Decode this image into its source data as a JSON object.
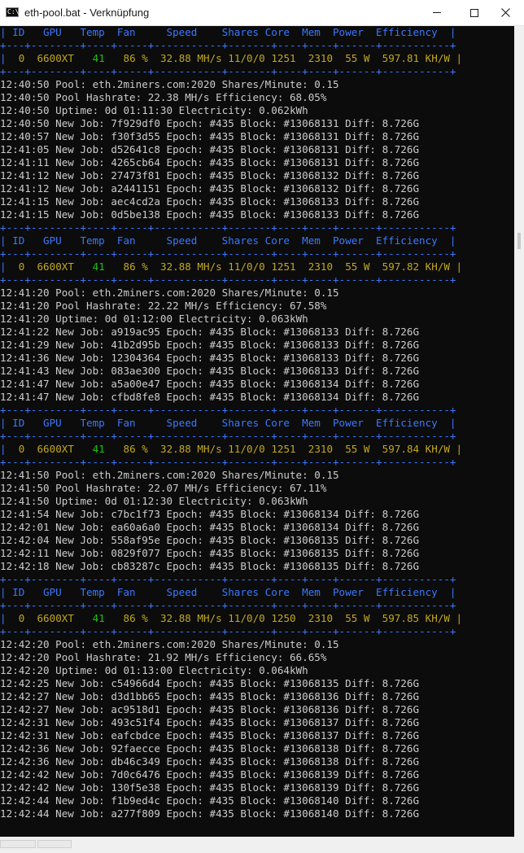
{
  "window": {
    "title": "eth-pool.bat - Verknüpfung",
    "icon": "cmd-icon",
    "controls": [
      "minimize-button",
      "maximize-button",
      "close-button"
    ]
  },
  "colors": {
    "background": "#0c0c0c",
    "table": "#3b78ff",
    "log_text": "#cccccc",
    "temp_green": "#16c60c",
    "value_yellow": "#c1a820"
  },
  "console": {
    "lines": [
      {
        "type": "hdr",
        "text": "| ID   GPU   Temp  Fan     Speed    Shares Core  Mem  Power  Efficiency  |"
      },
      {
        "type": "sep",
        "text": "+---+--------+----+-----+-----------+-------+----+----+------+-----------+"
      },
      {
        "type": "data",
        "id": "0",
        "gpu": "6600XT",
        "temp": "41",
        "rest": "86 %  32.88 MH/s 11/0/0 1251  2310  55 W  597.81 KH/W |"
      },
      {
        "type": "sep",
        "text": "+---+--------+----+-----+-----------+-------+----+----+------+-----------+"
      },
      {
        "type": "log",
        "text": "12:40:50 Pool: eth.2miners.com:2020 Shares/Minute: 0.15"
      },
      {
        "type": "log",
        "text": "12:40:50 Pool Hashrate: 22.38 MH/s Efficiency: 68.05%"
      },
      {
        "type": "log",
        "text": "12:40:50 Uptime: 0d 01:11:30 Electricity: 0.062kWh"
      },
      {
        "type": "log",
        "text": "12:40:50 New Job: 7f929df0 Epoch: #435 Block: #13068131 Diff: 8.726G"
      },
      {
        "type": "log",
        "text": "12:40:57 New Job: f30f3d55 Epoch: #435 Block: #13068131 Diff: 8.726G"
      },
      {
        "type": "log",
        "text": "12:41:05 New Job: d52641c8 Epoch: #435 Block: #13068131 Diff: 8.726G"
      },
      {
        "type": "log",
        "text": "12:41:11 New Job: 4265cb64 Epoch: #435 Block: #13068131 Diff: 8.726G"
      },
      {
        "type": "log",
        "text": "12:41:12 New Job: 27473f81 Epoch: #435 Block: #13068132 Diff: 8.726G"
      },
      {
        "type": "log",
        "text": "12:41:12 New Job: a2441151 Epoch: #435 Block: #13068132 Diff: 8.726G"
      },
      {
        "type": "log",
        "text": "12:41:15 New Job: aec4cd2a Epoch: #435 Block: #13068133 Diff: 8.726G"
      },
      {
        "type": "log",
        "text": "12:41:15 New Job: 0d5be138 Epoch: #435 Block: #13068133 Diff: 8.726G"
      },
      {
        "type": "sep",
        "text": "+---+--------+----+-----+-----------+-------+----+----+------+-----------+"
      },
      {
        "type": "hdr",
        "text": "| ID   GPU   Temp  Fan     Speed    Shares Core  Mem  Power  Efficiency  |"
      },
      {
        "type": "sep",
        "text": "+---+--------+----+-----+-----------+-------+----+----+------+-----------+"
      },
      {
        "type": "data",
        "id": "0",
        "gpu": "6600XT",
        "temp": "41",
        "rest": "86 %  32.88 MH/s 11/0/0 1251  2310  55 W  597.82 KH/W |"
      },
      {
        "type": "sep",
        "text": "+---+--------+----+-----+-----------+-------+----+----+------+-----------+"
      },
      {
        "type": "log",
        "text": "12:41:20 Pool: eth.2miners.com:2020 Shares/Minute: 0.15"
      },
      {
        "type": "log",
        "text": "12:41:20 Pool Hashrate: 22.22 MH/s Efficiency: 67.58%"
      },
      {
        "type": "log",
        "text": "12:41:20 Uptime: 0d 01:12:00 Electricity: 0.063kWh"
      },
      {
        "type": "log",
        "text": "12:41:22 New Job: a919ac95 Epoch: #435 Block: #13068133 Diff: 8.726G"
      },
      {
        "type": "log",
        "text": "12:41:29 New Job: 41b2d95b Epoch: #435 Block: #13068133 Diff: 8.726G"
      },
      {
        "type": "log",
        "text": "12:41:36 New Job: 12304364 Epoch: #435 Block: #13068133 Diff: 8.726G"
      },
      {
        "type": "log",
        "text": "12:41:43 New Job: 083ae300 Epoch: #435 Block: #13068133 Diff: 8.726G"
      },
      {
        "type": "log",
        "text": "12:41:47 New Job: a5a00e47 Epoch: #435 Block: #13068134 Diff: 8.726G"
      },
      {
        "type": "log",
        "text": "12:41:47 New Job: cfbd8fe8 Epoch: #435 Block: #13068134 Diff: 8.726G"
      },
      {
        "type": "sep",
        "text": "+---+--------+----+-----+-----------+-------+----+----+------+-----------+"
      },
      {
        "type": "hdr",
        "text": "| ID   GPU   Temp  Fan     Speed    Shares Core  Mem  Power  Efficiency  |"
      },
      {
        "type": "sep",
        "text": "+---+--------+----+-----+-----------+-------+----+----+------+-----------+"
      },
      {
        "type": "data",
        "id": "0",
        "gpu": "6600XT",
        "temp": "41",
        "rest": "86 %  32.88 MH/s 11/0/0 1251  2310  55 W  597.84 KH/W |"
      },
      {
        "type": "sep",
        "text": "+---+--------+----+-----+-----------+-------+----+----+------+-----------+"
      },
      {
        "type": "log",
        "text": "12:41:50 Pool: eth.2miners.com:2020 Shares/Minute: 0.15"
      },
      {
        "type": "log",
        "text": "12:41:50 Pool Hashrate: 22.07 MH/s Efficiency: 67.11%"
      },
      {
        "type": "log",
        "text": "12:41:50 Uptime: 0d 01:12:30 Electricity: 0.063kWh"
      },
      {
        "type": "log",
        "text": "12:41:54 New Job: c7bc1f73 Epoch: #435 Block: #13068134 Diff: 8.726G"
      },
      {
        "type": "log",
        "text": "12:42:01 New Job: ea60a6a0 Epoch: #435 Block: #13068134 Diff: 8.726G"
      },
      {
        "type": "log",
        "text": "12:42:04 New Job: 558af95e Epoch: #435 Block: #13068135 Diff: 8.726G"
      },
      {
        "type": "log",
        "text": "12:42:11 New Job: 0829f077 Epoch: #435 Block: #13068135 Diff: 8.726G"
      },
      {
        "type": "log",
        "text": "12:42:18 New Job: cb83287c Epoch: #435 Block: #13068135 Diff: 8.726G"
      },
      {
        "type": "sep",
        "text": "+---+--------+----+-----+-----------+-------+----+----+------+-----------+"
      },
      {
        "type": "hdr",
        "text": "| ID   GPU   Temp  Fan     Speed    Shares Core  Mem  Power  Efficiency  |"
      },
      {
        "type": "sep",
        "text": "+---+--------+----+-----+-----------+-------+----+----+------+-----------+"
      },
      {
        "type": "data",
        "id": "0",
        "gpu": "6600XT",
        "temp": "41",
        "rest": "86 %  32.88 MH/s 11/0/0 1250  2310  55 W  597.85 KH/W |"
      },
      {
        "type": "sep",
        "text": "+---+--------+----+-----+-----------+-------+----+----+------+-----------+"
      },
      {
        "type": "log",
        "text": "12:42:20 Pool: eth.2miners.com:2020 Shares/Minute: 0.15"
      },
      {
        "type": "log",
        "text": "12:42:20 Pool Hashrate: 21.92 MH/s Efficiency: 66.65%"
      },
      {
        "type": "log",
        "text": "12:42:20 Uptime: 0d 01:13:00 Electricity: 0.064kWh"
      },
      {
        "type": "log",
        "text": "12:42:25 New Job: c54966d4 Epoch: #435 Block: #13068135 Diff: 8.726G"
      },
      {
        "type": "log",
        "text": "12:42:27 New Job: d3d1bb65 Epoch: #435 Block: #13068136 Diff: 8.726G"
      },
      {
        "type": "log",
        "text": "12:42:27 New Job: ac9518d1 Epoch: #435 Block: #13068136 Diff: 8.726G"
      },
      {
        "type": "log",
        "text": "12:42:31 New Job: 493c51f4 Epoch: #435 Block: #13068137 Diff: 8.726G"
      },
      {
        "type": "log",
        "text": "12:42:31 New Job: eafcbdce Epoch: #435 Block: #13068137 Diff: 8.726G"
      },
      {
        "type": "log",
        "text": "12:42:36 New Job: 92faecce Epoch: #435 Block: #13068138 Diff: 8.726G"
      },
      {
        "type": "log",
        "text": "12:42:36 New Job: db46c349 Epoch: #435 Block: #13068138 Diff: 8.726G"
      },
      {
        "type": "log",
        "text": "12:42:42 New Job: 7d0c6476 Epoch: #435 Block: #13068139 Diff: 8.726G"
      },
      {
        "type": "log",
        "text": "12:42:42 New Job: 130f5e38 Epoch: #435 Block: #13068139 Diff: 8.726G"
      },
      {
        "type": "log",
        "text": "12:42:44 New Job: f1b9ed4c Epoch: #435 Block: #13068140 Diff: 8.726G"
      },
      {
        "type": "log",
        "text": "12:42:44 New Job: a277f809 Epoch: #435 Block: #13068140 Diff: 8.726G"
      }
    ]
  }
}
